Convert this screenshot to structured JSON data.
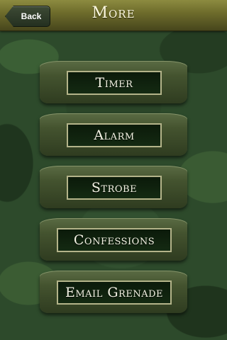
{
  "header": {
    "title": "More",
    "back_label": "Back"
  },
  "menu": {
    "items": [
      {
        "label": "Timer"
      },
      {
        "label": "Alarm"
      },
      {
        "label": "Strobe"
      },
      {
        "label": "Confessions"
      },
      {
        "label": "Email Grenade"
      }
    ]
  }
}
